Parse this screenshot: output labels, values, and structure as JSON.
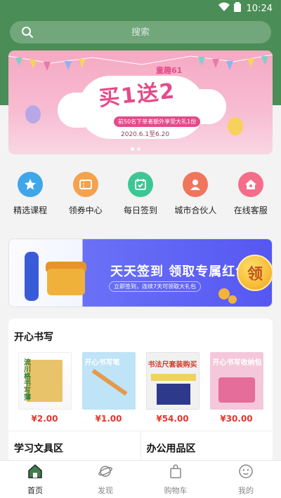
{
  "status_bar": {
    "time": "10:24"
  },
  "search": {
    "placeholder": "搜索"
  },
  "banner": {
    "tag": "童趣61",
    "headline": "买1送2",
    "subtitle": "前50名下单者额外享受大礼1份",
    "date_range": "2020.6.1至6.20"
  },
  "quick_nav": [
    {
      "label": "精选课程",
      "icon": "star-icon",
      "color": "#3fa6e9"
    },
    {
      "label": "领券中心",
      "icon": "coupon-icon",
      "color": "#f4a24d"
    },
    {
      "label": "每日签到",
      "icon": "calendar-check-icon",
      "color": "#3cc795"
    },
    {
      "label": "城市合伙人",
      "icon": "person-icon",
      "color": "#f0755c"
    },
    {
      "label": "在线客服",
      "icon": "home-chat-icon",
      "color": "#f46e8a"
    }
  ],
  "promo": {
    "title": "天天签到 领取专属红包",
    "subtitle": "立即签到，连续7天可领取大礼包",
    "button": "领"
  },
  "section": {
    "title": "开心书写",
    "products": [
      {
        "image_text": "流川格书写薄",
        "price": "¥2.00"
      },
      {
        "image_text": "开心书写笔",
        "price": "¥1.00"
      },
      {
        "image_text": "书法尺套装购买",
        "price": "¥54.00"
      },
      {
        "image_text": "开心书写收纳包",
        "price": "¥30.00"
      }
    ],
    "sub_sections": [
      "学习文具区",
      "办公用品区"
    ]
  },
  "tabbar": [
    {
      "label": "首页",
      "icon": "home-icon",
      "active": true
    },
    {
      "label": "发现",
      "icon": "planet-icon",
      "active": false
    },
    {
      "label": "购物车",
      "icon": "shopping-bag-icon",
      "active": false
    },
    {
      "label": "我的",
      "icon": "face-icon",
      "active": false
    }
  ],
  "colors": {
    "brand_green": "#4b8d56",
    "price_red": "#e4362c"
  }
}
